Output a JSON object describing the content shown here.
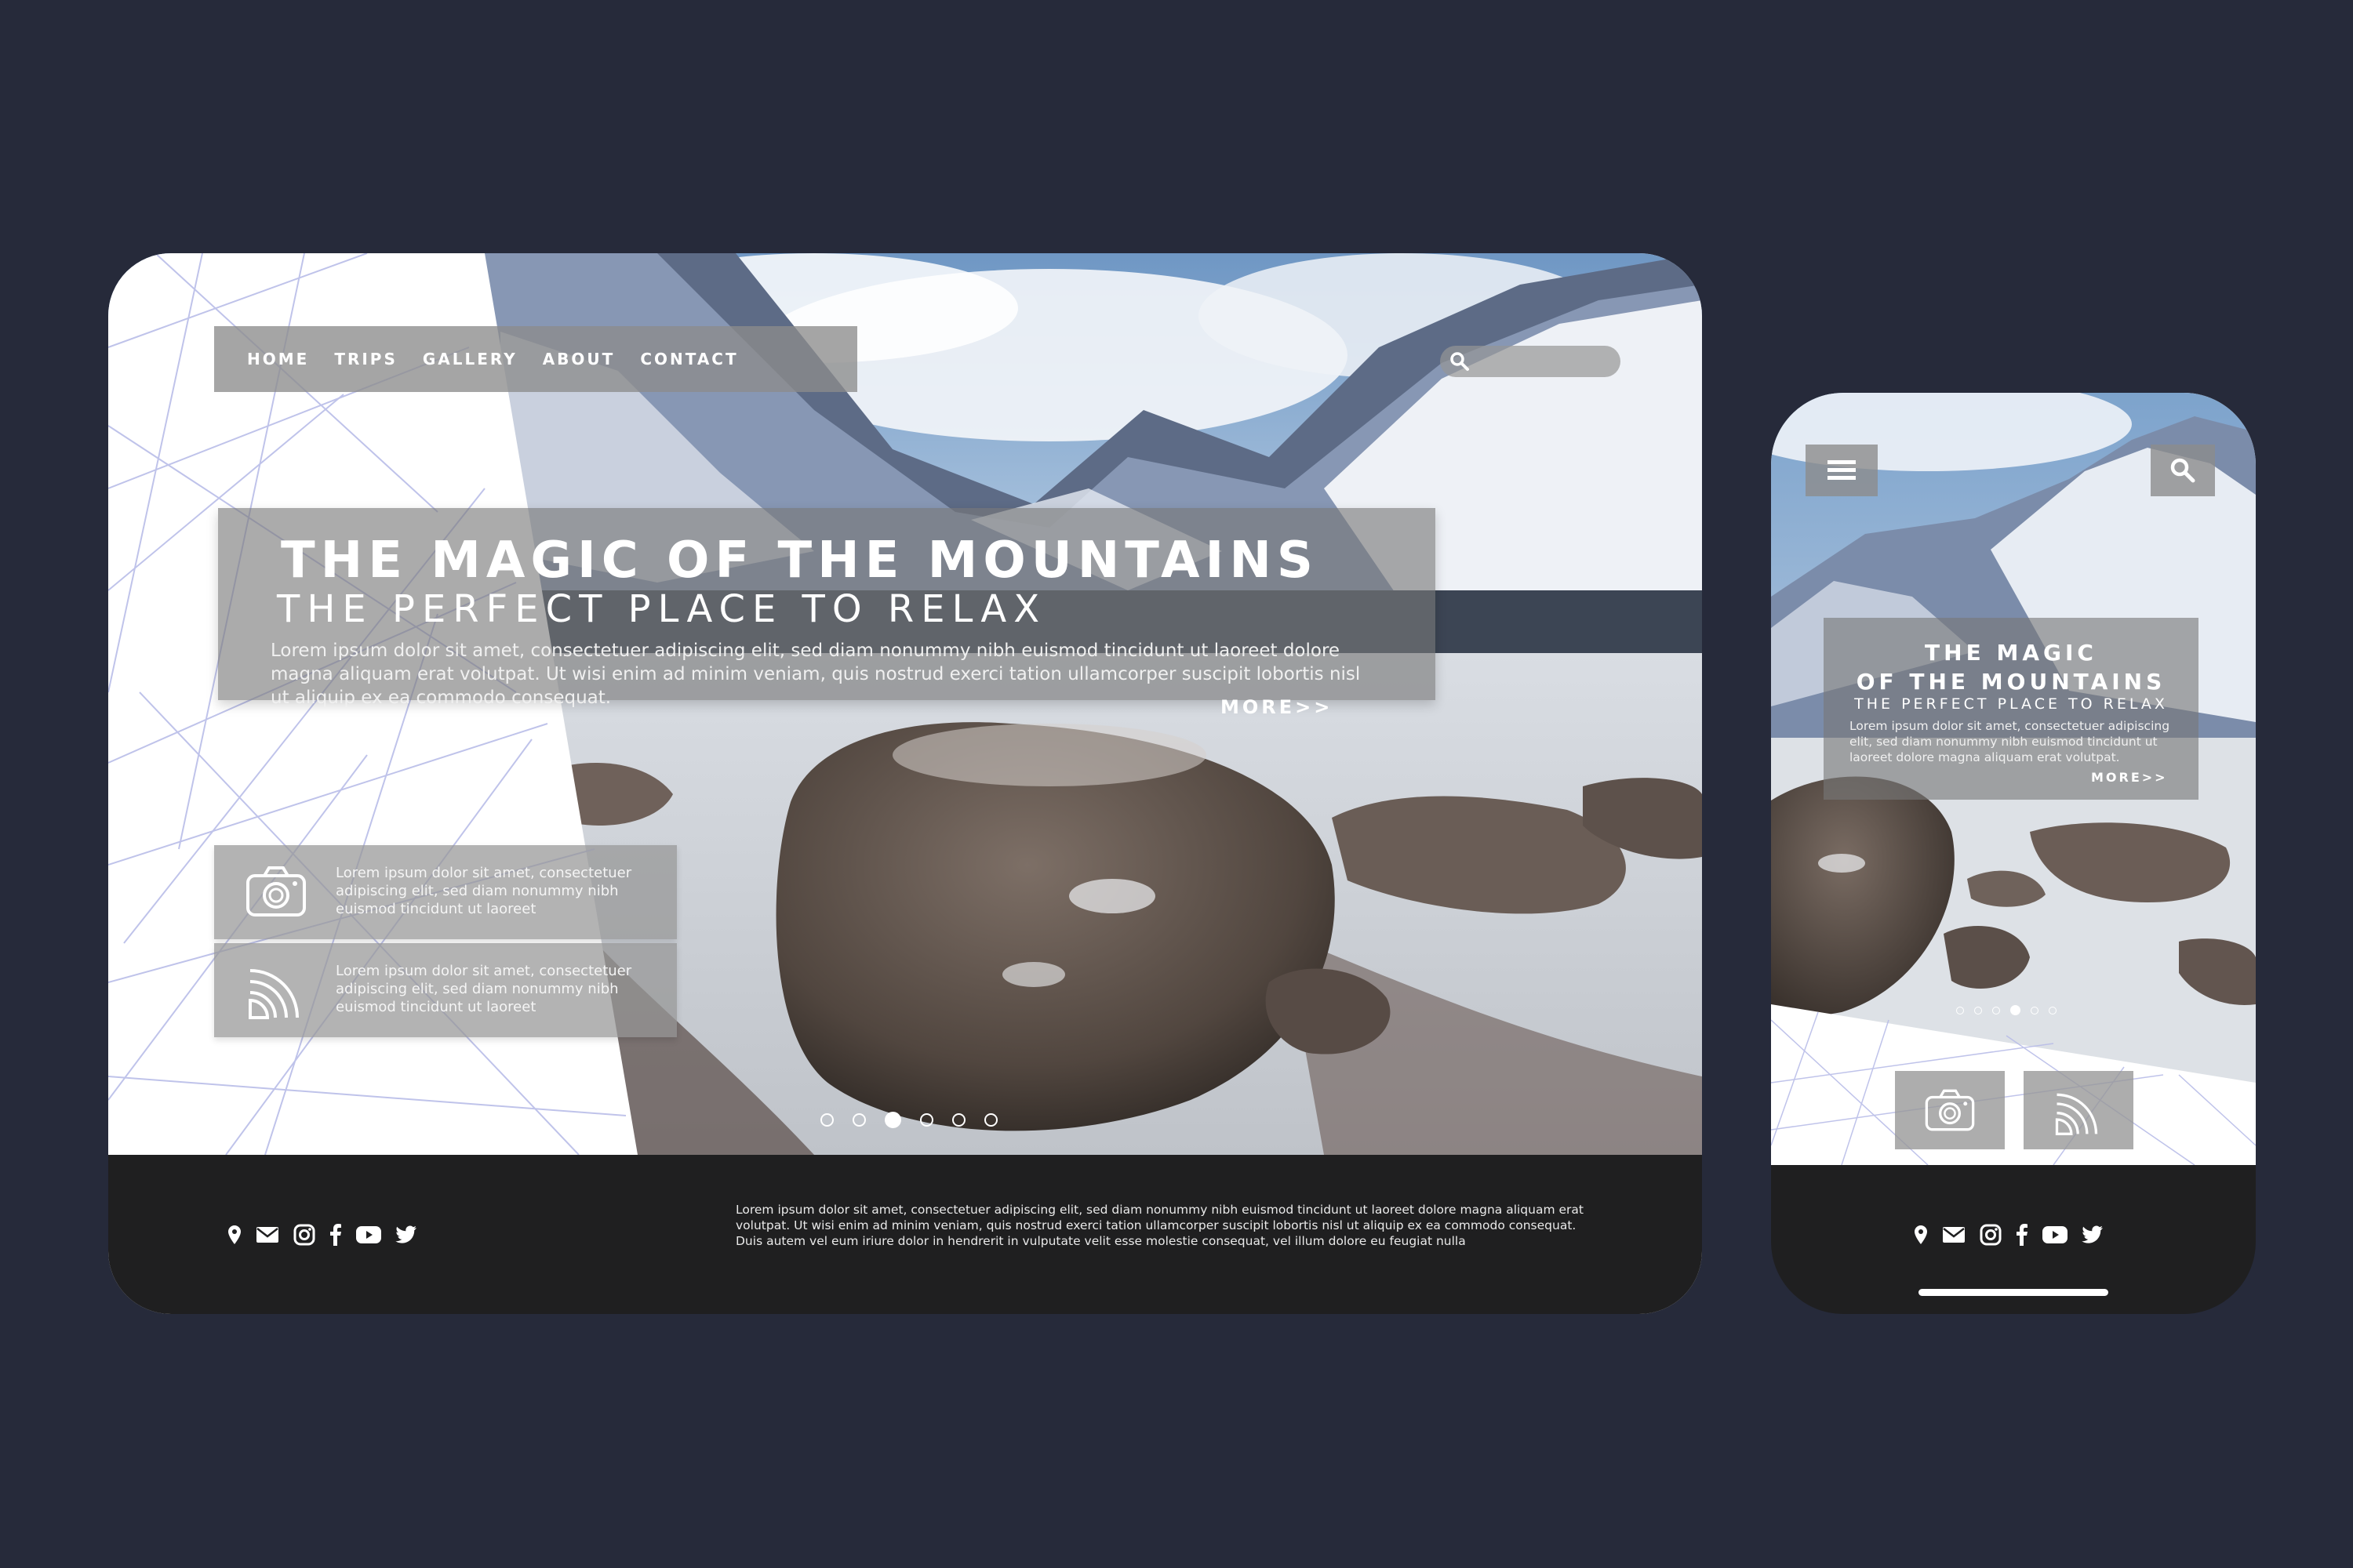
{
  "colors": {
    "page_bg": "#262a3a",
    "footer_bg": "#1f1f20",
    "panel": "#8c8c8c",
    "text": "#ffffff",
    "lines": "#b9bde8"
  },
  "desktop": {
    "nav": {
      "items": [
        {
          "label": "HOME"
        },
        {
          "label": "TRIPS"
        },
        {
          "label": "GALLERY"
        },
        {
          "label": "ABOUT"
        },
        {
          "label": "CONTACT"
        }
      ]
    },
    "search": {
      "icon": "search-icon"
    },
    "hero": {
      "title": "THE MAGIC OF THE MOUNTAINS",
      "subtitle": "THE PERFECT PLACE TO RELAX",
      "body": "Lorem ipsum dolor sit amet, consectetuer adipiscing elit, sed diam nonummy nibh euismod tincidunt ut laoreet dolore magna aliquam erat volutpat. Ut wisi enim ad minim veniam, quis nostrud exerci tation ullamcorper suscipit lobortis nisl ut aliquip ex ea commodo consequat.",
      "more": "MORE>>"
    },
    "cards": [
      {
        "icon": "camera-icon",
        "text": "Lorem ipsum dolor sit amet, consectetuer adipiscing elit, sed diam nonummy nibh euismod tincidunt ut laoreet"
      },
      {
        "icon": "rss-icon",
        "text": "Lorem ipsum dolor sit amet, consectetuer adipiscing elit, sed diam nonummy nibh euismod tincidunt ut laoreet"
      }
    ],
    "slider": {
      "count": 6,
      "active": 3
    },
    "footer": {
      "social": [
        "location-icon",
        "mail-icon",
        "instagram-icon",
        "facebook-icon",
        "youtube-icon",
        "twitter-icon"
      ],
      "text": "Lorem ipsum dolor sit amet, consectetuer adipiscing elit, sed diam nonummy nibh euismod tincidunt ut laoreet dolore magna aliquam erat volutpat. Ut wisi enim ad minim veniam, quis nostrud exerci tation ullamcorper suscipit lobortis nisl ut aliquip ex ea commodo consequat. Duis autem vel eum iriure dolor in hendrerit in vulputate velit esse molestie consequat, vel illum dolore eu feugiat nulla"
    }
  },
  "mobile": {
    "menu_icon": "hamburger-menu-icon",
    "search_icon": "search-icon",
    "hero": {
      "title_line1": "THE MAGIC",
      "title_line2": "OF THE MOUNTAINS",
      "subtitle": "THE PERFECT PLACE TO RELAX",
      "body": "Lorem ipsum dolor sit amet, consectetuer adipiscing elit, sed diam nonummy nibh euismod tincidunt ut laoreet dolore magna aliquam erat volutpat.",
      "more": "MORE>>"
    },
    "slider": {
      "count": 6,
      "active": 4
    },
    "cards": [
      {
        "icon": "camera-icon"
      },
      {
        "icon": "rss-icon"
      }
    ],
    "footer": {
      "social": [
        "location-icon",
        "mail-icon",
        "instagram-icon",
        "facebook-icon",
        "youtube-icon",
        "twitter-icon"
      ]
    }
  }
}
